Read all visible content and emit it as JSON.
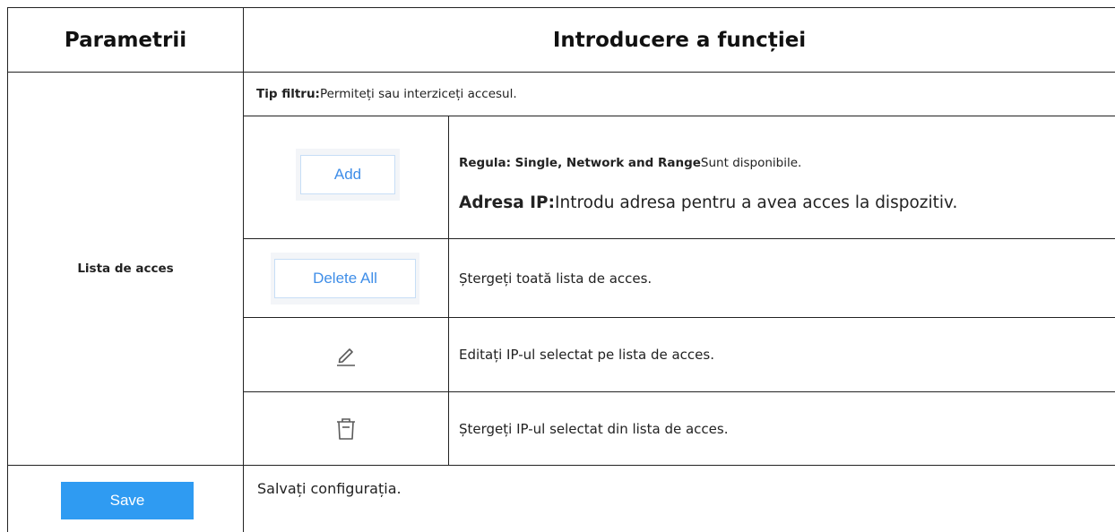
{
  "header": {
    "col1": "Parametrii",
    "col2": "Introducere a funcției"
  },
  "access_list": {
    "label": "Lista de acces",
    "filter_label": "Tip filtru:",
    "filter_text": "Permiteți sau interziceți accesul.",
    "rows": [
      {
        "button_label": "Add",
        "lines": [
          {
            "bold": "Regula: Single, Network and Range",
            "text": "Sunt disponibile."
          },
          {
            "bold": "Adresa IP:",
            "text": "Introdu adresa pentru a avea acces la dispozitiv."
          }
        ]
      },
      {
        "button_label": "Delete All",
        "text": "Ștergeți toată lista de acces."
      },
      {
        "icon": "edit-pencil-icon",
        "text": "Editați IP-ul selectat pe lista de acces."
      },
      {
        "icon": "trash-icon",
        "text": "Ștergeți IP-ul selectat din lista de acces."
      }
    ]
  },
  "save_row": {
    "button_label": "Save",
    "text": "Salvați configurația."
  },
  "colors": {
    "accent": "#2f9bf2",
    "outline_text": "#3f8ee8",
    "border": "#222222"
  }
}
